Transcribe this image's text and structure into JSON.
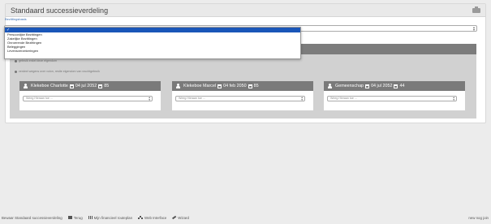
{
  "card": {
    "title": "Standaard successieverdeling",
    "field_label": "Bezittingsbasis"
  },
  "dropdown": {
    "selected": "✓",
    "options": [
      "Persoonlijke Bezittingen",
      "Zakelijke Bezittingen",
      "Onroerende Bezittingen",
      "Beleggingen",
      "Levensverzekeringen"
    ]
  },
  "radios": [
    "gebruik enkel deze eigendom",
    "verdeel wegens over volon, restte eigendom van vruchtgebruik"
  ],
  "persons": [
    {
      "name": "Klekeboe Charlotte",
      "date": "04 jul 2052",
      "age": "85",
      "placeholder": "Weeg Hieraan toe ..."
    },
    {
      "name": "Klekeboe Marcel",
      "date": "04 feb 2050",
      "age": "85",
      "placeholder": "Weeg Hieraan toe ..."
    },
    {
      "name": "Gemeenschap",
      "date": "04 jul 2052",
      "age": "44",
      "placeholder": "Weeg Hieraan toe ..."
    }
  ],
  "footer": {
    "items": [
      "Bewaar Standaard successieverdeling",
      "Terug",
      "Mijn financieel routeplan",
      "Web Interface",
      "Wizard"
    ],
    "right": "new nog join"
  },
  "icons": {
    "header": "briefcase-icon",
    "person": "user-icon",
    "date": "calendar-icon"
  }
}
